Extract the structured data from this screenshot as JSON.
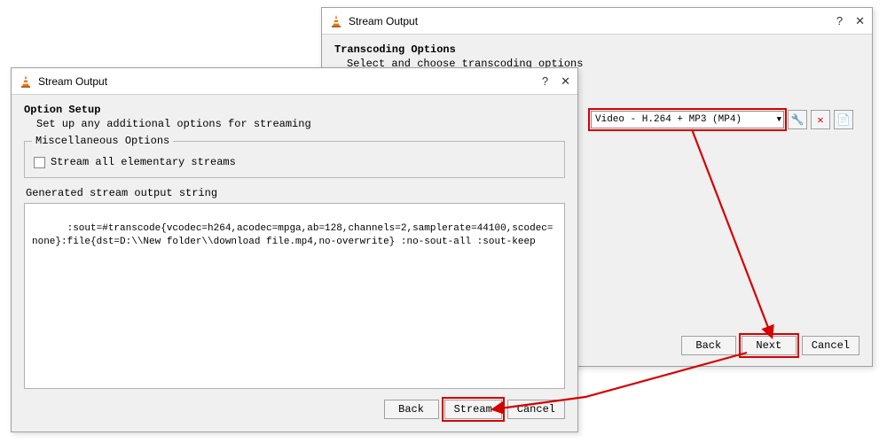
{
  "window2": {
    "title": "Stream Output",
    "heading": "Transcoding Options",
    "subheading": "Select and choose transcoding options",
    "profile_value": "Video - H.264 + MP3 (MP4)",
    "buttons": {
      "back": "Back",
      "next": "Next",
      "cancel": "Cancel"
    }
  },
  "window1": {
    "title": "Stream Output",
    "heading": "Option Setup",
    "subheading": "Set up any additional options for streaming",
    "group_misc_label": "Miscellaneous Options",
    "checkbox_label": "Stream all elementary streams",
    "group_output_label": "Generated stream output string",
    "output_string": ":sout=#transcode{vcodec=h264,acodec=mpga,ab=128,channels=2,samplerate=44100,scodec=none}:file{dst=D:\\\\New folder\\\\download file.mp4,no-overwrite} :no-sout-all :sout-keep",
    "buttons": {
      "back": "Back",
      "stream": "Stream",
      "cancel": "Cancel"
    }
  }
}
